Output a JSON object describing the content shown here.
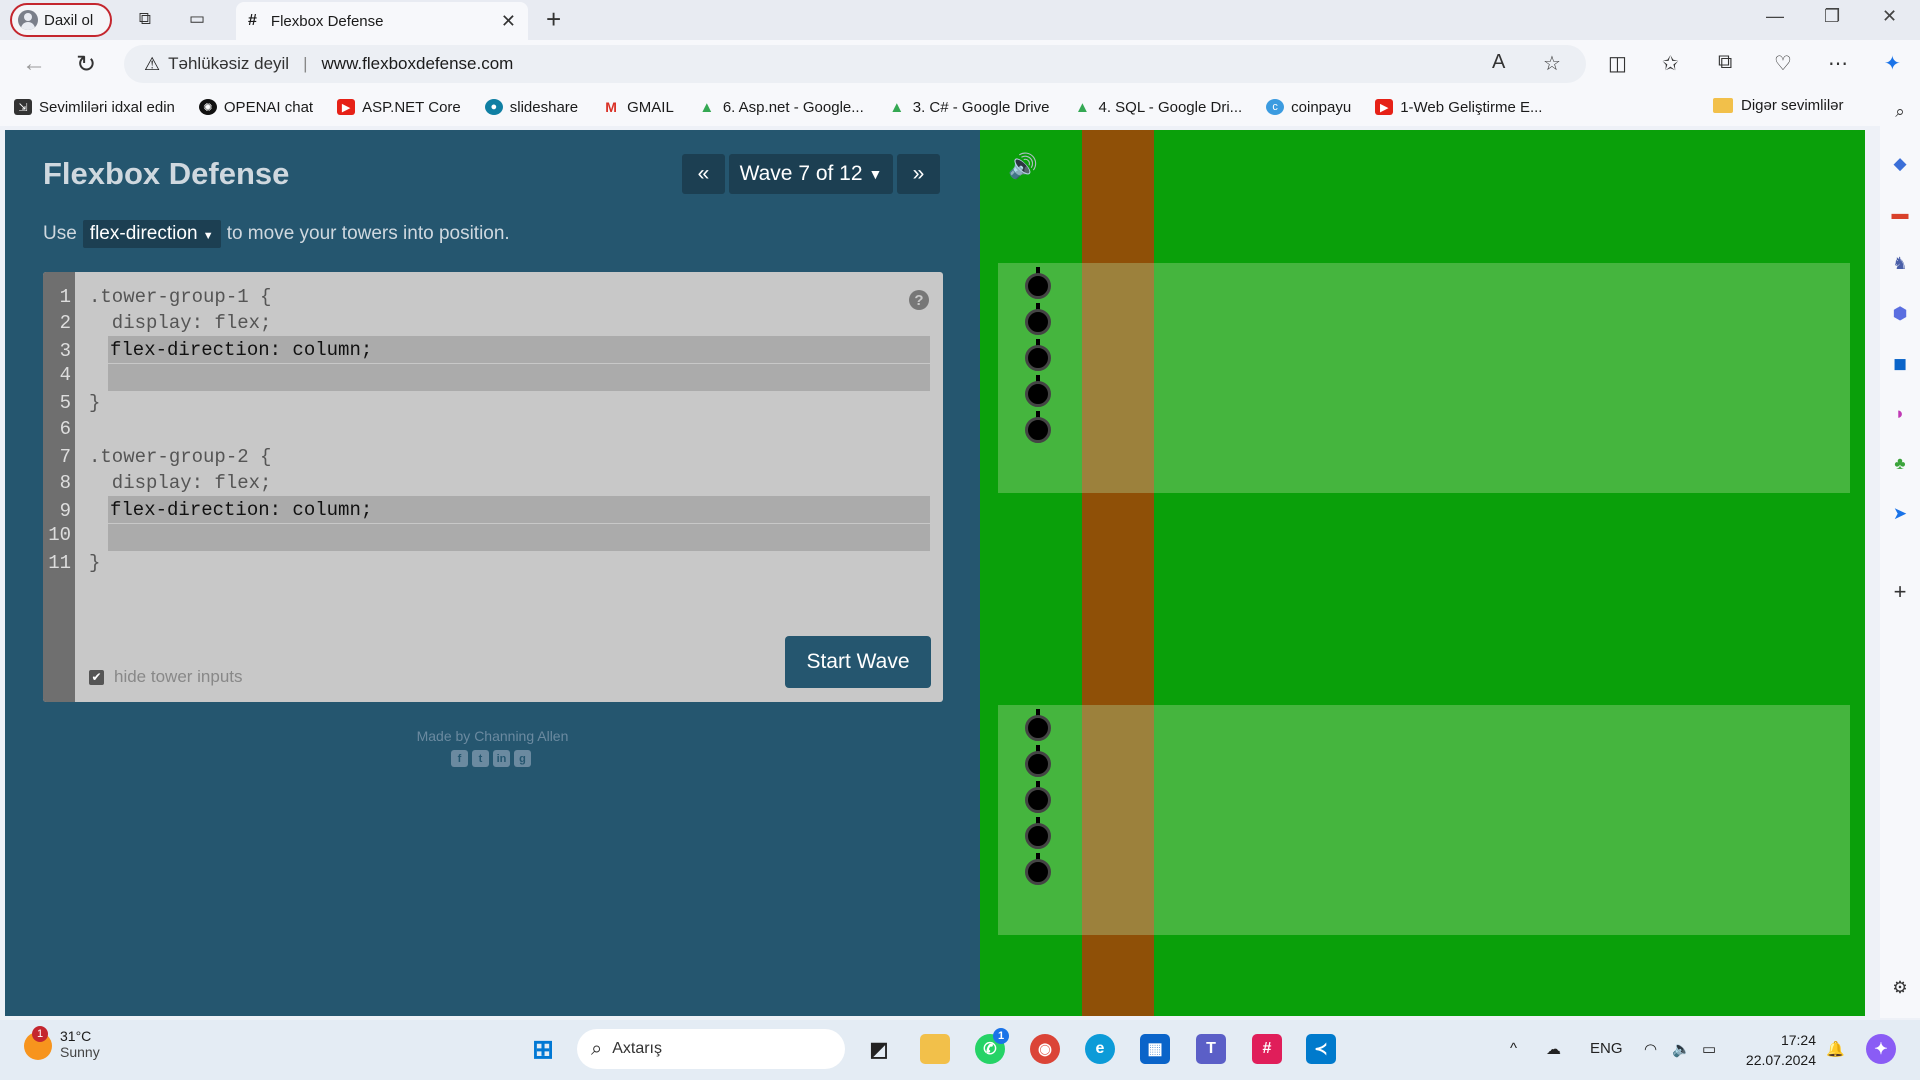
{
  "browser": {
    "profile_label": "Daxil ol",
    "tab_title": "Flexbox Defense",
    "security_label": "Təhlükəsiz deyil",
    "url": "www.flexboxdefense.com",
    "bookmarks": [
      {
        "label": "Sevimliləri idxal edin",
        "icon": "import-icon",
        "color": "#333333"
      },
      {
        "label": "OPENAI chat",
        "icon": "openai-icon",
        "color": "#111111"
      },
      {
        "label": "ASP.NET Core",
        "icon": "youtube-icon",
        "color": "#e62117"
      },
      {
        "label": "slideshare",
        "icon": "slideshare-icon",
        "color": "#0f7fa3"
      },
      {
        "label": "GMAIL",
        "icon": "gmail-icon",
        "color": "#d93025"
      },
      {
        "label": "6. Asp.net - Google...",
        "icon": "drive-icon",
        "color": "#34a853"
      },
      {
        "label": "3. C# - Google Drive",
        "icon": "drive-icon",
        "color": "#34a853"
      },
      {
        "label": "4. SQL - Google Dri...",
        "icon": "drive-icon",
        "color": "#34a853"
      },
      {
        "label": "coinpayu",
        "icon": "coinpayu-icon",
        "color": "#3b9be0"
      },
      {
        "label": "1-Web Geliştirme E...",
        "icon": "youtube-icon",
        "color": "#e62117"
      }
    ],
    "other_bookmarks": "Digər sevimlilər"
  },
  "game": {
    "title": "Flexbox Defense",
    "wave_label": "Wave 7 of 12",
    "prev_glyph": "«",
    "next_glyph": "»",
    "instruction_prefix": "Use",
    "property": "flex-direction",
    "instruction_suffix": "to move your towers into position.",
    "line_numbers": [
      "1",
      "2",
      "3",
      "4",
      "5",
      "6",
      "7",
      "8",
      "9",
      "10",
      "11"
    ],
    "code": {
      "l1": ".tower-group-1 {",
      "l2": "  display: flex;",
      "l3": "flex-direction: column;",
      "l4": "",
      "l5": "}",
      "l7": ".tower-group-2 {",
      "l8": "  display: flex;",
      "l9": "flex-direction: column;",
      "l10": "",
      "l11": "}"
    },
    "help_glyph": "?",
    "start_label": "Start Wave",
    "hide_inputs_label": "hide tower inputs",
    "hide_inputs_checked": true,
    "credit": "Made by Channing Allen",
    "field_colors": {
      "grass": "#0aa00a",
      "road": "#8f5007"
    },
    "tower_groups": [
      {
        "towers": 5
      },
      {
        "towers": 5
      }
    ]
  },
  "taskbar": {
    "temperature": "31°C",
    "condition": "Sunny",
    "weather_badge": "1",
    "search_placeholder": "Axtarış",
    "whatsapp_badge": "1",
    "language": "ENG",
    "time": "17:24",
    "date": "22.07.2024"
  }
}
